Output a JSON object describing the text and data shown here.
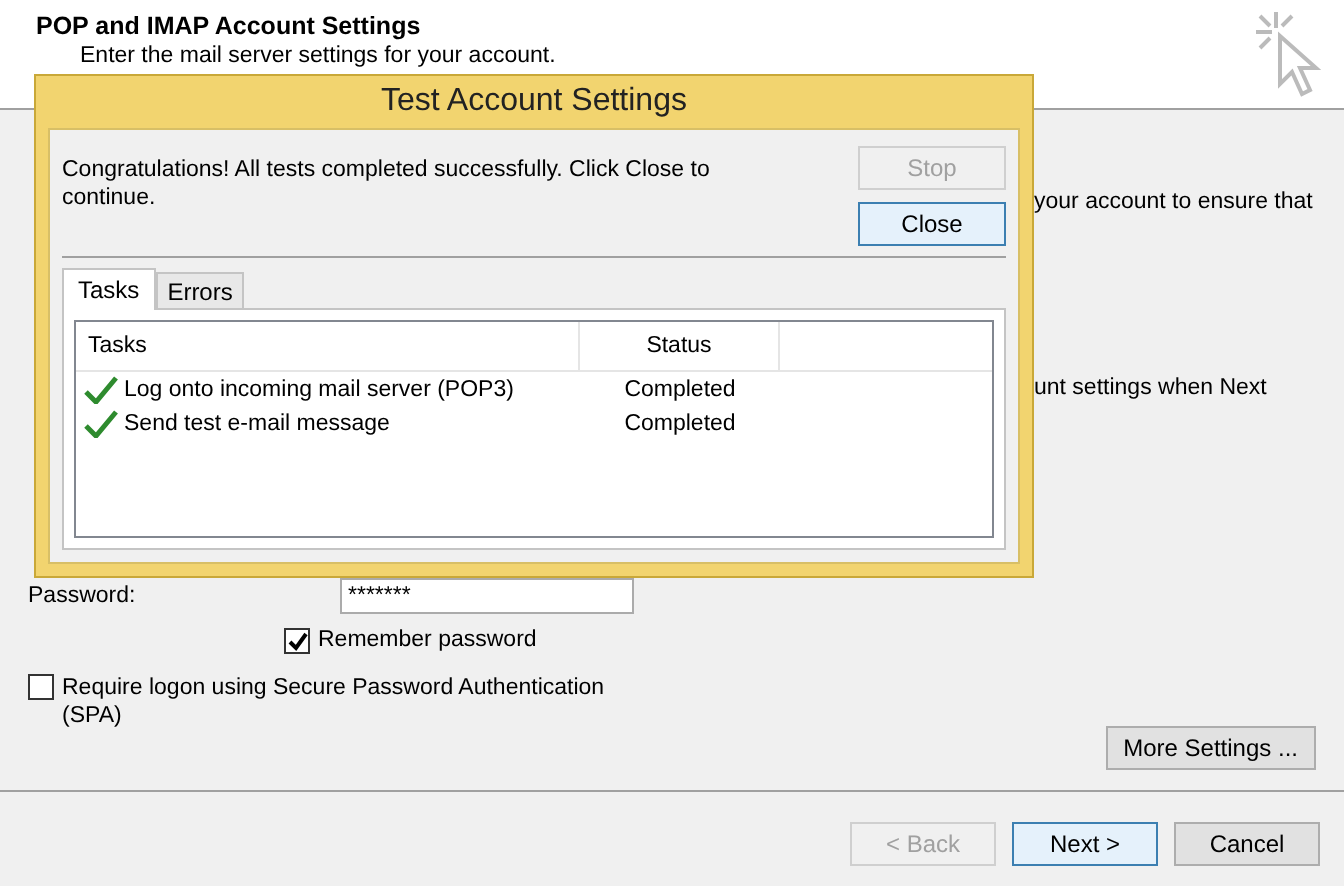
{
  "window": {
    "title": "POP and IMAP Account Settings",
    "subtitle": "Enter the mail server settings for your account."
  },
  "background_texts": [
    "your account to ensure that",
    "unt settings when Next"
  ],
  "password": {
    "label": "Password:",
    "value": "*******"
  },
  "remember_password": {
    "label": "Remember password",
    "checked": true
  },
  "spa": {
    "label": "Require logon using Secure Password Authentication (SPA)",
    "checked": false
  },
  "more_settings": "More Settings ...",
  "buttons": [
    {
      "label": "< Back",
      "disabled": true,
      "focused": false
    },
    {
      "label": "Next >",
      "disabled": false,
      "focused": true
    },
    {
      "label": "Cancel",
      "disabled": false,
      "focused": false
    }
  ],
  "dialog": {
    "title": "Test Account Settings",
    "message": "Congratulations! All tests completed successfully. Click Close to continue.",
    "buttons": [
      {
        "label": "Stop",
        "disabled": true,
        "focused": false
      },
      {
        "label": "Close",
        "disabled": false,
        "focused": true
      }
    ],
    "tabs": [
      {
        "label": "Tasks",
        "selected": true
      },
      {
        "label": "Errors",
        "selected": false
      }
    ],
    "table": {
      "columns": [
        "Tasks",
        "Status"
      ],
      "rows": [
        {
          "task": "Log onto incoming mail server (POP3)",
          "status": "Completed",
          "done": true
        },
        {
          "task": "Send test e-mail message",
          "status": "Completed",
          "done": true
        }
      ]
    }
  }
}
